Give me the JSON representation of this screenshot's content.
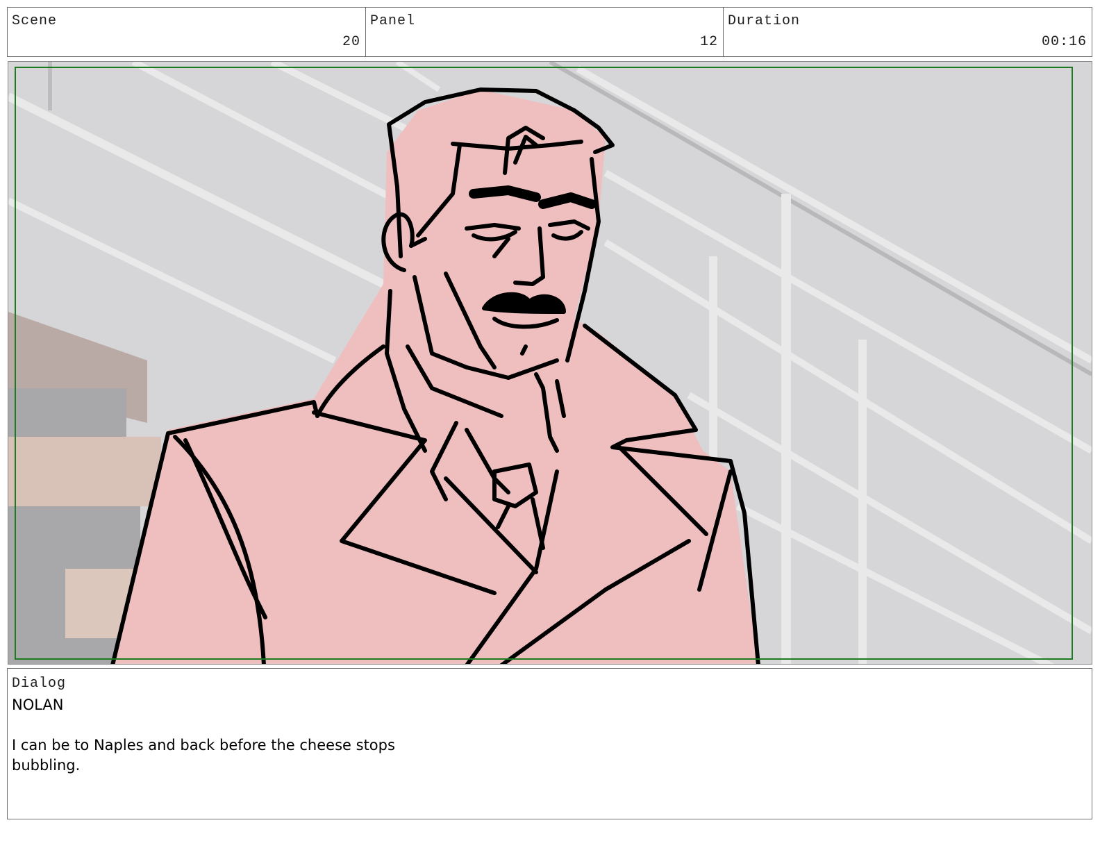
{
  "header": {
    "scene": {
      "label": "Scene",
      "value": "20"
    },
    "panel": {
      "label": "Panel",
      "value": "12"
    },
    "duration": {
      "label": "Duration",
      "value": "00:16"
    }
  },
  "frame": {
    "safe_area_color": "#1e7a1e",
    "character_fill": "#efbfbf",
    "background_color": "#d4d4d6"
  },
  "dialog": {
    "label": "Dialog",
    "speaker": "NOLAN",
    "line_1": "I can be to Naples and back before the cheese stops",
    "line_2": "bubbling."
  }
}
